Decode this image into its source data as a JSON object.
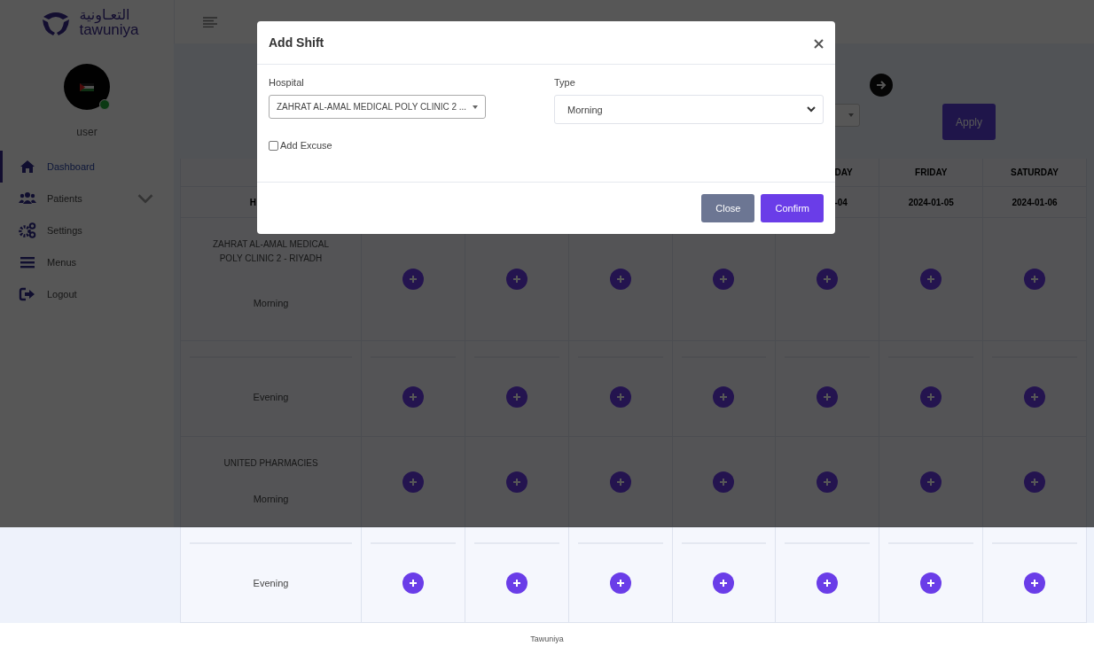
{
  "logo": {
    "arabic": "التعـاونية",
    "latin": "tawuniya"
  },
  "user": {
    "name": "user",
    "online": true
  },
  "nav": [
    {
      "label": "Dashboard",
      "selected": true,
      "expandable": false
    },
    {
      "label": "Patients",
      "selected": false,
      "expandable": true
    },
    {
      "label": "Settings",
      "selected": false,
      "expandable": false
    },
    {
      "label": "Menus",
      "selected": false,
      "expandable": false
    },
    {
      "label": "Logout",
      "selected": false,
      "expandable": false
    }
  ],
  "filters": {
    "apply": "Apply"
  },
  "table": {
    "columns": [
      {
        "date": "H"
      },
      {},
      {},
      {},
      {},
      {
        "day": "DAY",
        "date": "-04"
      },
      {
        "day": "FRIDAY",
        "date": "2024-01-05"
      },
      {
        "day": "SATURDAY",
        "date": "2024-01-06"
      }
    ],
    "rows": [
      {
        "hospital": "ZAHRAT AL-AMAL MEDICAL POLY CLINIC 2 - RIYADH",
        "shift": "Morning"
      },
      {
        "shift": "Evening"
      },
      {
        "hospital": "UNITED PHARMACIES",
        "shift": "Morning"
      },
      {
        "shift": "Evening"
      }
    ]
  },
  "footer": "Tawuniya",
  "modal": {
    "title": "Add Shift",
    "fields": [
      {
        "label": "Hospital",
        "value": "ZAHRAT AL-AMAL MEDICAL POLY CLINIC 2 ...",
        "kind": "searchable"
      },
      {
        "label": "Type",
        "value": "Morning",
        "kind": "select"
      }
    ],
    "checkbox": {
      "label": "Add Excuse",
      "checked": false
    },
    "buttons": [
      {
        "label": "Close",
        "kind": "secondary"
      },
      {
        "label": "Confirm",
        "kind": "primary"
      }
    ]
  }
}
